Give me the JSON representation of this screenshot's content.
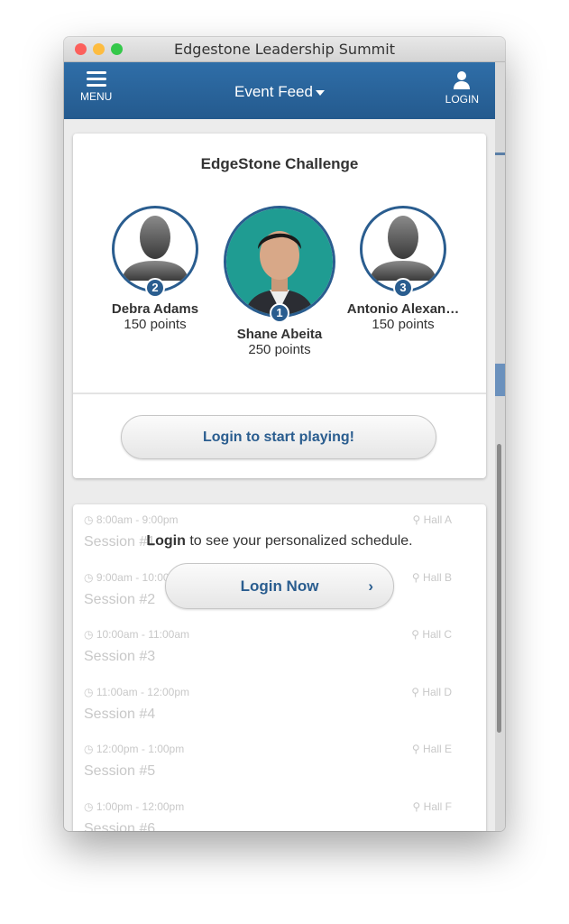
{
  "window": {
    "title": "Edgestone Leadership Summit"
  },
  "header": {
    "menu_label": "MENU",
    "feed_label": "Event Feed",
    "login_label": "LOGIN"
  },
  "challenge": {
    "title": "EdgeStone Challenge",
    "players": [
      {
        "rank": "1",
        "name": "Shane Abeita",
        "points": "250 points"
      },
      {
        "rank": "2",
        "name": "Debra Adams",
        "points": "150 points"
      },
      {
        "rank": "3",
        "name": "Antonio Alexan…",
        "points": "150 points"
      }
    ],
    "cta": "Login to start playing!"
  },
  "schedule": {
    "prompt_bold": "Login",
    "prompt_rest": " to see your personalized schedule.",
    "login_button": "Login Now",
    "sessions": [
      {
        "time": "8:00am - 9:00pm",
        "hall": "Hall A",
        "name": "Session #1"
      },
      {
        "time": "9:00am - 10:00am",
        "hall": "Hall B",
        "name": "Session #2"
      },
      {
        "time": "10:00am - 11:00am",
        "hall": "Hall C",
        "name": "Session #3"
      },
      {
        "time": "11:00am - 12:00pm",
        "hall": "Hall D",
        "name": "Session #4"
      },
      {
        "time": "12:00pm - 1:00pm",
        "hall": "Hall E",
        "name": "Session #5"
      },
      {
        "time": "1:00pm - 12:00pm",
        "hall": "Hall F",
        "name": "Session #6"
      }
    ]
  },
  "colors": {
    "brand": "#2a5d8f",
    "header": "#2a66a0"
  }
}
